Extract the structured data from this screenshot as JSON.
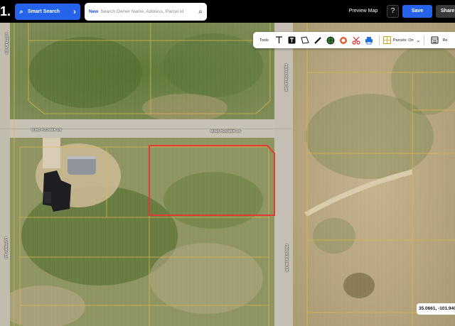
{
  "topbar": {
    "logo_text": "1.",
    "smart_search_label": "Smart Search",
    "search_new_tag": "New",
    "search_placeholder": "Search Owner Name, Address, Parcel id",
    "preview_map_label": "Preview Map",
    "help_label": "?",
    "save_label": "Save",
    "share_label": "Share"
  },
  "tools": {
    "label": "Tools",
    "parcels_label": "Parcels: On",
    "report_label": "Re"
  },
  "map": {
    "streets": {
      "wind_flower_left": "WIND FLOWER LN",
      "wind_flower_right": "WIND FLOWER LN",
      "periwinkle_top": "PERIWINKLE DR",
      "periwinkle_bottom": "PERIWINKLE DR",
      "left_top": "LOTTERY LN",
      "left_bottom": "LOTTERY LN"
    },
    "coordinates": "35.0661, -101.940"
  },
  "colors": {
    "accent": "#2563eb",
    "selected_parcel": "#e53935",
    "parcel_line": "#e0b84a"
  }
}
